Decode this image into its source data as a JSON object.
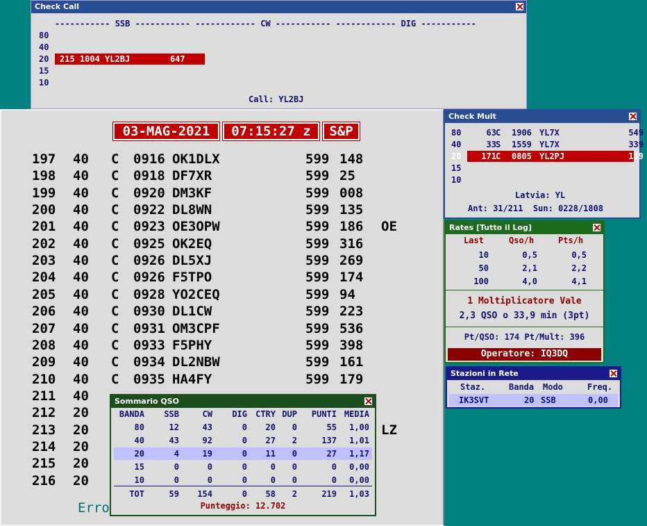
{
  "check_call": {
    "title": "Check Call",
    "header": "----------- SSB ----------- ------------ CW ----------- ------------ DIG -----------",
    "bands": [
      "80",
      "40",
      "20",
      "15",
      "10"
    ],
    "hit_text": "215 1004 YL2BJ        647",
    "call_label": "Call: YL2BJ"
  },
  "main": {
    "date": "03-MAG-2021",
    "time": "07:15:27 z",
    "mode": "S&P",
    "rows": [
      {
        "nr": "197",
        "band": "40",
        "mode": "C",
        "time": "0916",
        "call": "OK1DLX",
        "rst": "599",
        "rcvd": "148",
        "mult": ""
      },
      {
        "nr": "198",
        "band": "40",
        "mode": "C",
        "time": "0918",
        "call": "DF7XR",
        "rst": "599",
        "rcvd": "25",
        "mult": ""
      },
      {
        "nr": "199",
        "band": "40",
        "mode": "C",
        "time": "0920",
        "call": "DM3KF",
        "rst": "599",
        "rcvd": "008",
        "mult": ""
      },
      {
        "nr": "200",
        "band": "40",
        "mode": "C",
        "time": "0922",
        "call": "DL8WN",
        "rst": "599",
        "rcvd": "135",
        "mult": ""
      },
      {
        "nr": "201",
        "band": "40",
        "mode": "C",
        "time": "0923",
        "call": "OE3OPW",
        "rst": "599",
        "rcvd": "186",
        "mult": "OE"
      },
      {
        "nr": "202",
        "band": "40",
        "mode": "C",
        "time": "0925",
        "call": "OK2EQ",
        "rst": "599",
        "rcvd": "316",
        "mult": ""
      },
      {
        "nr": "203",
        "band": "40",
        "mode": "C",
        "time": "0926",
        "call": "DL5XJ",
        "rst": "599",
        "rcvd": "269",
        "mult": ""
      },
      {
        "nr": "204",
        "band": "40",
        "mode": "C",
        "time": "0926",
        "call": "F5TPO",
        "rst": "599",
        "rcvd": "174",
        "mult": ""
      },
      {
        "nr": "205",
        "band": "40",
        "mode": "C",
        "time": "0928",
        "call": "YO2CEQ",
        "rst": "599",
        "rcvd": "94",
        "mult": ""
      },
      {
        "nr": "206",
        "band": "40",
        "mode": "C",
        "time": "0930",
        "call": "DL1CW",
        "rst": "599",
        "rcvd": "223",
        "mult": ""
      },
      {
        "nr": "207",
        "band": "40",
        "mode": "C",
        "time": "0931",
        "call": "OM3CPF",
        "rst": "599",
        "rcvd": "536",
        "mult": ""
      },
      {
        "nr": "208",
        "band": "40",
        "mode": "C",
        "time": "0933",
        "call": "F5PHY",
        "rst": "599",
        "rcvd": "398",
        "mult": ""
      },
      {
        "nr": "209",
        "band": "40",
        "mode": "C",
        "time": "0934",
        "call": "DL2NBW",
        "rst": "599",
        "rcvd": "161",
        "mult": ""
      },
      {
        "nr": "210",
        "band": "40",
        "mode": "C",
        "time": "0935",
        "call": "HA4FY",
        "rst": "599",
        "rcvd": "179",
        "mult": ""
      },
      {
        "nr": "211",
        "band": "40",
        "mode": "",
        "time": "",
        "call": "",
        "rst": "",
        "rcvd": "",
        "mult": ""
      },
      {
        "nr": "212",
        "band": "20",
        "mode": "",
        "time": "",
        "call": "",
        "rst": "",
        "rcvd": "",
        "mult": ""
      },
      {
        "nr": "213",
        "band": "20",
        "mode": "",
        "time": "",
        "call": "",
        "rst": "",
        "rcvd": "",
        "mult": "LZ"
      },
      {
        "nr": "214",
        "band": "20",
        "mode": "",
        "time": "",
        "call": "",
        "rst": "",
        "rcvd": "",
        "mult": ""
      },
      {
        "nr": "215",
        "band": "20",
        "mode": "",
        "time": "",
        "call": "",
        "rst": "",
        "rcvd": "",
        "mult": ""
      },
      {
        "nr": "216",
        "band": "20",
        "mode": "",
        "time": "",
        "call": "",
        "rst": "",
        "rcvd": "",
        "mult": ""
      }
    ],
    "status_text": "Erro"
  },
  "check_mult": {
    "title": "Check Mult",
    "rows": [
      {
        "band": "80",
        "nr": "63",
        "mode": "C",
        "time": "1906",
        "call": "YL7X",
        "rcvd": "549"
      },
      {
        "band": "40",
        "nr": "33",
        "mode": "S",
        "time": "1559",
        "call": "YL7X",
        "rcvd": "339"
      },
      {
        "band": "20",
        "nr": "171",
        "mode": "C",
        "time": "0805",
        "call": "YL2PJ",
        "rcvd": "169"
      },
      {
        "band": "15",
        "nr": "",
        "mode": "",
        "time": "",
        "call": "",
        "rcvd": ""
      },
      {
        "band": "10",
        "nr": "",
        "mode": "",
        "time": "",
        "call": "",
        "rcvd": ""
      }
    ],
    "country": "Latvia: YL",
    "ant_sun": "Ant: 31/211  Sun: 0228/1808"
  },
  "rates": {
    "title": "Rates [Tutto il Log]",
    "headers": [
      "Last",
      "Qso/h",
      "Pts/h"
    ],
    "rows": [
      [
        "10",
        "0,5",
        "0,5"
      ],
      [
        "50",
        "2,1",
        "2,2"
      ],
      [
        "100",
        "4,0",
        "4,1"
      ]
    ],
    "mult_line": "1 Moltiplicatore Vale",
    "mult_value": "2,3 QSO o 33,9 min (3pt)",
    "pt_line": "Pt/QSO: 174 Pt/Mult: 396",
    "operator": "Operatore: IQ3DQ"
  },
  "network": {
    "title": "Stazioni in Rete",
    "headers": [
      "Staz.",
      "Banda",
      "Modo",
      "Freq."
    ],
    "row": [
      "IK3SVT",
      "20",
      "SSB",
      "0,00"
    ]
  },
  "summary": {
    "title": "Sommario QSO",
    "headers": [
      "BANDA",
      "SSB",
      "CW",
      "DIG",
      "CTRY",
      "DUP",
      "PUNTI",
      "MEDIA"
    ],
    "rows": [
      [
        "80",
        "12",
        "43",
        "0",
        "20",
        "0",
        "55",
        "1,00"
      ],
      [
        "40",
        "43",
        "92",
        "0",
        "27",
        "2",
        "137",
        "1,01"
      ],
      [
        "20",
        "4",
        "19",
        "0",
        "11",
        "0",
        "27",
        "1,17"
      ],
      [
        "15",
        "0",
        "0",
        "0",
        "0",
        "0",
        "0",
        "0,00"
      ],
      [
        "10",
        "0",
        "0",
        "0",
        "0",
        "0",
        "0",
        "0,00"
      ]
    ],
    "total": [
      "TOT",
      "59",
      "154",
      "0",
      "58",
      "2",
      "219",
      "1,03"
    ],
    "score": "Punteggio: 12.702"
  }
}
